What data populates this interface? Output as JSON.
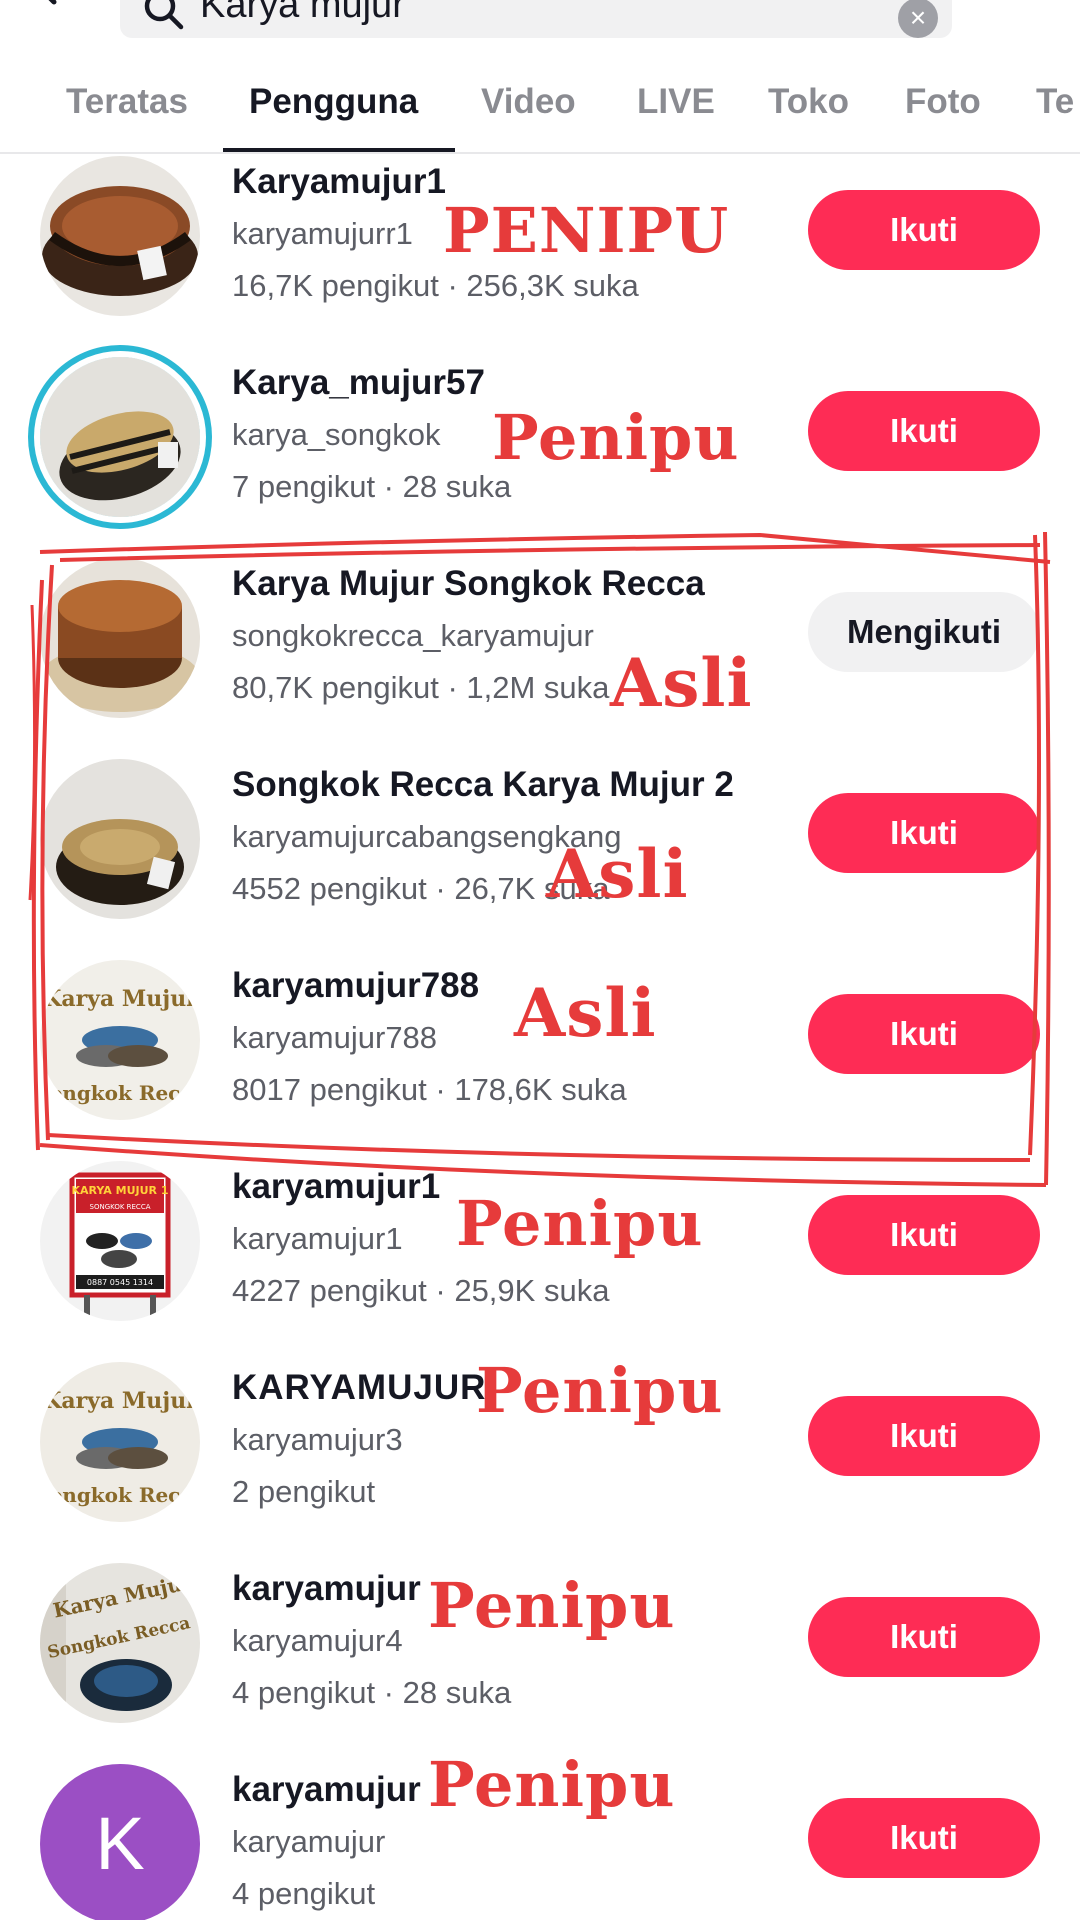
{
  "search": {
    "query": "Karya mujur",
    "back_icon": "chevron-left-icon",
    "search_icon": "search-icon",
    "clear_icon": "clear-icon"
  },
  "tabs": [
    {
      "label": "Teratas"
    },
    {
      "label": "Pengguna",
      "active": true
    },
    {
      "label": "Video"
    },
    {
      "label": "LIVE"
    },
    {
      "label": "Toko"
    },
    {
      "label": "Foto"
    },
    {
      "label": "Te"
    }
  ],
  "colors": {
    "accent": "#fe2c55",
    "annotation": "#e63b3b",
    "ring": "#2bb8d4"
  },
  "users": [
    {
      "name": "Karyamujur1",
      "handle": "karyamujurr1",
      "stats": "16,7K pengikut · 256,3K suka",
      "button": "Ikuti",
      "note": "PENIPU"
    },
    {
      "name": "Karya_mujur57",
      "handle": "karya_songkok",
      "stats": "7 pengikut · 28 suka",
      "button": "Ikuti",
      "note": "Penipu"
    },
    {
      "name": "Karya Mujur Songkok Recca",
      "handle": "songkokrecca_karyamujur",
      "stats": "80,7K pengikut · 1,2M suka",
      "button": "Mengikuti",
      "note": "Asli"
    },
    {
      "name": "Songkok Recca Karya Mujur 2",
      "handle": "karyamujurcabangsengkang",
      "stats": "4552 pengikut · 26,7K suka",
      "button": "Ikuti",
      "note": "Asli"
    },
    {
      "name": "karyamujur788",
      "handle": "karyamujur788",
      "stats": "8017 pengikut · 178,6K suka",
      "button": "Ikuti",
      "note": "Asli"
    },
    {
      "name": "karyamujur1",
      "handle": "karyamujur1",
      "stats": "4227 pengikut · 25,9K suka",
      "button": "Ikuti",
      "note": "Penipu"
    },
    {
      "name": "KARYAMUJUR",
      "handle": "karyamujur3",
      "stats": "2 pengikut",
      "button": "Ikuti",
      "note": "Penipu"
    },
    {
      "name": "karyamujur",
      "handle": "karyamujur4",
      "stats": "4 pengikut · 28 suka",
      "button": "Ikuti",
      "note": "Penipu"
    },
    {
      "name": "karyamujur",
      "handle": "karyamujur",
      "stats": "4 pengikut",
      "button": "Ikuti",
      "note": "Penipu",
      "avatar_letter": "K"
    }
  ],
  "avatar_texts": {
    "karya_mujur": "Karya Mujur",
    "songkok_recca": "Songkok Recca",
    "sign_title": "KARYA MUJUR 1",
    "sign_sub": "SONGKOK RECCA",
    "sign_phone": "0887 0545 1314"
  }
}
